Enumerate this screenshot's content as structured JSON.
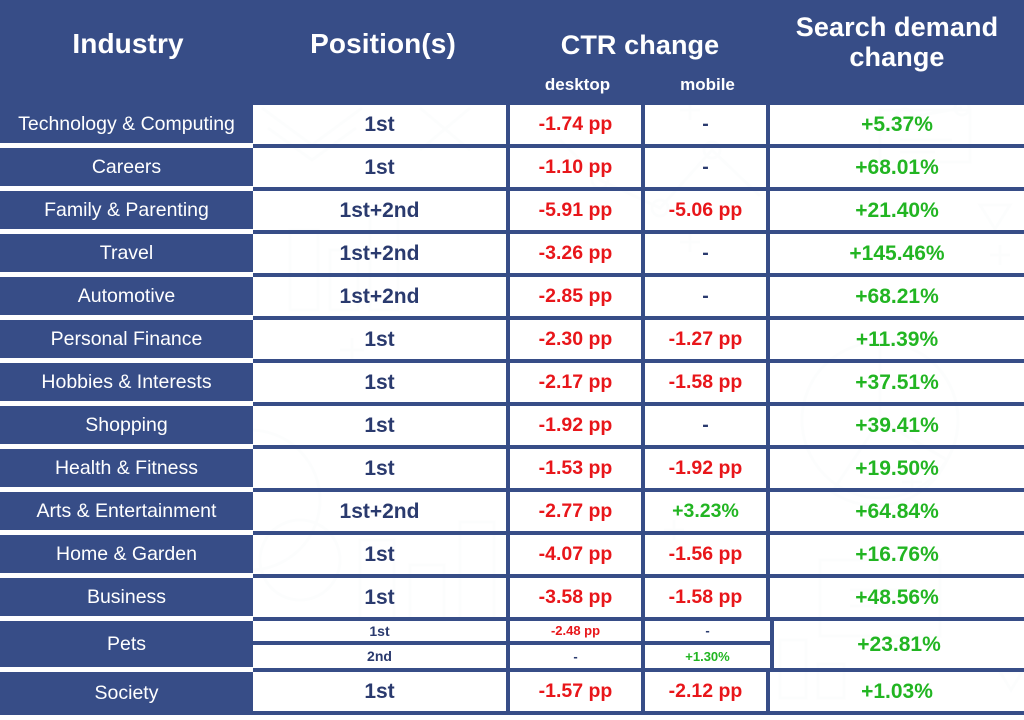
{
  "theme": {
    "header_bg": "#374d87",
    "row_label_bg": "#374d87",
    "negative_color": "#e8161a",
    "positive_color": "#22b522",
    "neutral_color": "#2a3a6e",
    "page_bg": "#ffffff"
  },
  "header": {
    "industry": "Industry",
    "positions": "Position(s)",
    "ctr_change": "CTR change",
    "ctr_desktop": "desktop",
    "ctr_mobile": "mobile",
    "search_demand": "Search demand change"
  },
  "chart_data": {
    "type": "table",
    "title": "Industry CTR change and Search demand change",
    "columns": [
      "Industry",
      "Position(s)",
      "CTR change desktop",
      "CTR change mobile",
      "Search demand change"
    ],
    "rows": [
      {
        "industry": "Technology & Computing",
        "positions": "1st",
        "desktop": "-1.74 pp",
        "mobile": "-",
        "demand": "+5.37%"
      },
      {
        "industry": "Careers",
        "positions": "1st",
        "desktop": "-1.10 pp",
        "mobile": "-",
        "demand": "+68.01%"
      },
      {
        "industry": "Family & Parenting",
        "positions": "1st+2nd",
        "desktop": "-5.91 pp",
        "mobile": "-5.06 pp",
        "demand": "+21.40%"
      },
      {
        "industry": "Travel",
        "positions": "1st+2nd",
        "desktop": "-3.26 pp",
        "mobile": "-",
        "demand": "+145.46%"
      },
      {
        "industry": "Automotive",
        "positions": "1st+2nd",
        "desktop": "-2.85 pp",
        "mobile": "-",
        "demand": "+68.21%"
      },
      {
        "industry": "Personal Finance",
        "positions": "1st",
        "desktop": "-2.30 pp",
        "mobile": "-1.27 pp",
        "demand": "+11.39%"
      },
      {
        "industry": "Hobbies & Interests",
        "positions": "1st",
        "desktop": "-2.17 pp",
        "mobile": "-1.58 pp",
        "demand": "+37.51%"
      },
      {
        "industry": "Shopping",
        "positions": "1st",
        "desktop": "-1.92 pp",
        "mobile": "-",
        "demand": "+39.41%"
      },
      {
        "industry": "Health & Fitness",
        "positions": "1st",
        "desktop": "-1.53 pp",
        "mobile": "-1.92 pp",
        "demand": "+19.50%"
      },
      {
        "industry": "Arts & Entertainment",
        "positions": "1st+2nd",
        "desktop": "-2.77 pp",
        "mobile": "+3.23%",
        "demand": "+64.84%"
      },
      {
        "industry": "Home & Garden",
        "positions": "1st",
        "desktop": "-4.07 pp",
        "mobile": "-1.56 pp",
        "demand": "+16.76%"
      },
      {
        "industry": "Business",
        "positions": "1st",
        "desktop": "-3.58 pp",
        "mobile": "-1.58 pp",
        "demand": "+48.56%"
      }
    ],
    "split_row": {
      "industry": "Pets",
      "demand": "+23.81%",
      "sub_rows": [
        {
          "positions": "1st",
          "desktop": "-2.48 pp",
          "mobile": "-"
        },
        {
          "positions": "2nd",
          "desktop": "-",
          "mobile": "+1.30%"
        }
      ]
    },
    "last_row": {
      "industry": "Society",
      "positions": "1st",
      "desktop": "-1.57 pp",
      "mobile": "-2.12 pp",
      "demand": "+1.03%"
    }
  }
}
